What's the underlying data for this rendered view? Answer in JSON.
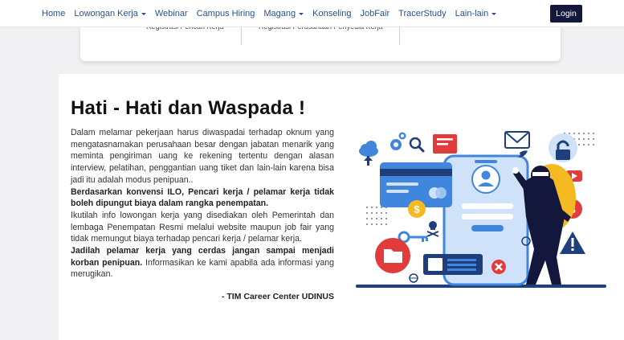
{
  "navbar": {
    "items": [
      {
        "label": "Home",
        "dropdown": false
      },
      {
        "label": "Lowongan Kerja",
        "dropdown": true
      },
      {
        "label": "Webinar",
        "dropdown": false
      },
      {
        "label": "Campus Hiring",
        "dropdown": false
      },
      {
        "label": "Magang",
        "dropdown": true
      },
      {
        "label": "Konseling",
        "dropdown": false
      },
      {
        "label": "JobFair",
        "dropdown": false
      },
      {
        "label": "TracerStudy",
        "dropdown": false
      },
      {
        "label": "Lain-lain",
        "dropdown": true
      }
    ],
    "login_label": "Login"
  },
  "registration": {
    "job_seeker": "Registrasi Pencari Kerja",
    "company": "Registrasi Perusahaan Penyedia Kerja"
  },
  "warning": {
    "title": "Hati - Hati dan Waspada !",
    "para1": "Dalam melamar pekerjaan harus diwaspadai terhadap oknum yang mengatasnamakan perusahaan besar dengan jabatan menarik yang meminta pengiriman uang ke rekening tertentu dengan alasan interview, pelatihan, penggantian uang tiket dan lain-lain karena bisa jadi itu adalah modus penipuan..",
    "para2_bold": "Berdasarkan konvensi ILO, Pencari kerja / pelamar kerja tidak boleh dipungut biaya dalam rangka penempatan.",
    "para3": "Ikutilah info lowongan kerja yang disediakan oleh Pemerintah dan lembaga Penempatan Resmi melalui website maupun job fair yang tidak memungut biaya terhadap pencari kerja / pelamar kerja.",
    "para4_bold": "Jadilah pelamar kerja yang cerdas jangan sampai menjadi korban penipuan.",
    "para4_rest": " Informasikan ke kami apabila ada informasi yang merugikan.",
    "signature": "- TIM Career Center UDINUS"
  },
  "colors": {
    "nav_text": "#2a4f8a",
    "login_bg": "#14173c",
    "phone_blue": "#3f86dc",
    "danger_red": "#e23b3b",
    "warning_yellow": "#f5b921"
  }
}
